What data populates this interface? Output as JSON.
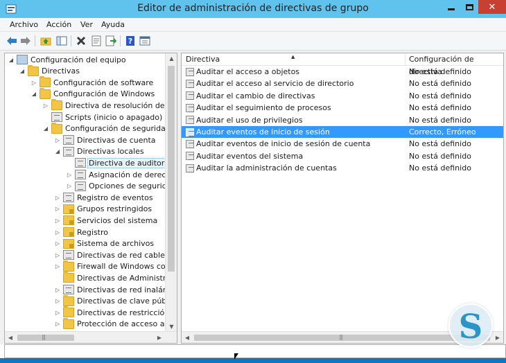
{
  "window": {
    "title": "Editor de administración de directivas de grupo",
    "close_glyph": "✕"
  },
  "menu": [
    "Archivo",
    "Acción",
    "Ver",
    "Ayuda"
  ],
  "toolbar_icons": [
    "back-arrow-icon",
    "forward-arrow-icon",
    "up-folder-icon",
    "show-hide-tree-icon",
    "delete-icon",
    "properties-icon",
    "export-list-icon",
    "help-icon",
    "view-icon"
  ],
  "tree": [
    {
      "label": "Configuración del equipo",
      "expander": "◢",
      "icon": "computer"
    },
    {
      "label": "Directivas",
      "expander": "◢",
      "icon": "folder"
    },
    {
      "label": "Configuración de software",
      "expander": "▷",
      "icon": "folder"
    },
    {
      "label": "Configuración de Windows",
      "expander": "◢",
      "icon": "folder"
    },
    {
      "label": "Directiva de resolución de no",
      "expander": "▷",
      "icon": "folder"
    },
    {
      "label": "Scripts (inicio o apagado)",
      "expander": "",
      "icon": "policy"
    },
    {
      "label": "Configuración de seguridad",
      "expander": "◢",
      "icon": "folder"
    },
    {
      "label": "Directivas de cuenta",
      "expander": "▷",
      "icon": "policy"
    },
    {
      "label": "Directivas locales",
      "expander": "◢",
      "icon": "policy"
    },
    {
      "label": "Directiva de auditoría",
      "expander": "",
      "icon": "policy",
      "selected": true
    },
    {
      "label": "Asignación de derech",
      "expander": "▷",
      "icon": "policy"
    },
    {
      "label": "Opciones de segurida",
      "expander": "▷",
      "icon": "policy"
    },
    {
      "label": "Registro de eventos",
      "expander": "▷",
      "icon": "policy"
    },
    {
      "label": "Grupos restringidos",
      "expander": "▷",
      "icon": "lock"
    },
    {
      "label": "Servicios del sistema",
      "expander": "▷",
      "icon": "lock"
    },
    {
      "label": "Registro",
      "expander": "▷",
      "icon": "lock"
    },
    {
      "label": "Sistema de archivos",
      "expander": "▷",
      "icon": "lock"
    },
    {
      "label": "Directivas de red cableada",
      "expander": "▷",
      "icon": "policy"
    },
    {
      "label": "Firewall de Windows con",
      "expander": "▷",
      "icon": "folder"
    },
    {
      "label": "Directivas de Administrad",
      "expander": "",
      "icon": "folder"
    },
    {
      "label": "Directivas de red inalámb",
      "expander": "▷",
      "icon": "policy"
    },
    {
      "label": "Directivas de clave públic",
      "expander": "▷",
      "icon": "folder"
    },
    {
      "label": "Directivas de restricción d",
      "expander": "▷",
      "icon": "folder"
    },
    {
      "label": "Protección de acceso a re",
      "expander": "▷",
      "icon": "folder"
    }
  ],
  "list": {
    "columns": [
      "Directiva",
      "Configuración de directiva"
    ],
    "rows": [
      {
        "name": "Auditar el acceso a objetos",
        "value": "No está definido"
      },
      {
        "name": "Auditar el acceso al servicio de directorio",
        "value": "No está definido"
      },
      {
        "name": "Auditar el cambio de directivas",
        "value": "No está definido"
      },
      {
        "name": "Auditar el seguimiento de procesos",
        "value": "No está definido"
      },
      {
        "name": "Auditar el uso de privilegios",
        "value": "No está definido"
      },
      {
        "name": "Auditar eventos de inicio de sesión",
        "value": "Correcto, Erróneo",
        "selected": true
      },
      {
        "name": "Auditar eventos de inicio de sesión de cuenta",
        "value": "No está definido"
      },
      {
        "name": "Auditar eventos del sistema",
        "value": "No está definido"
      },
      {
        "name": "Auditar la administración de cuentas",
        "value": "No está definido"
      }
    ]
  },
  "colors": {
    "titlebar": "#5fc3ee",
    "close": "#c84031",
    "selection": "#3399ff",
    "taskbar": "#0e77bd"
  }
}
